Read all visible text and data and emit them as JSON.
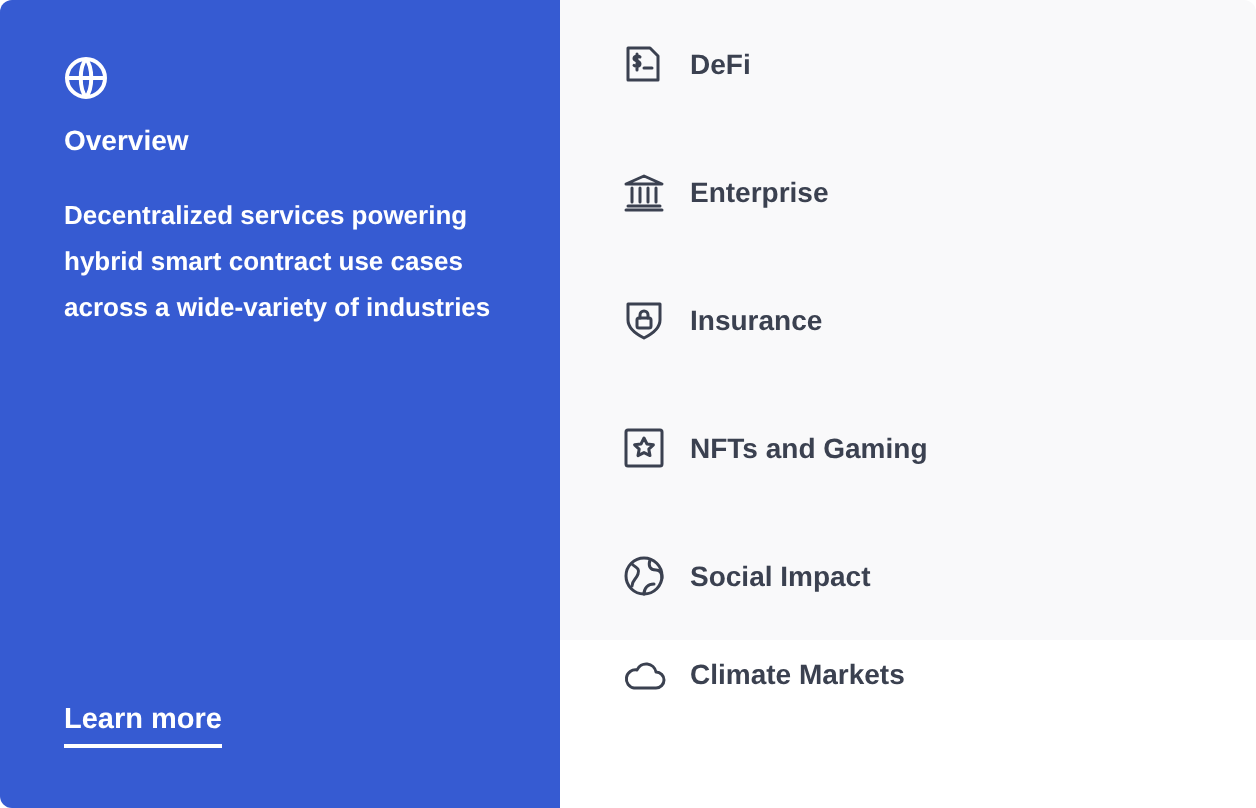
{
  "overview": {
    "title": "Overview",
    "description": "Decentralized services powering hybrid smart contract use cases across a wide-variety of industries",
    "link": "Learn more"
  },
  "categories": [
    {
      "kind": "document",
      "label": "DeFi"
    },
    {
      "kind": "bank",
      "label": "Enterprise"
    },
    {
      "kind": "shield",
      "label": "Insurance"
    },
    {
      "kind": "star",
      "label": "NFTs and Gaming"
    },
    {
      "kind": "globe",
      "label": "Social Impact"
    },
    {
      "kind": "cloud",
      "label": "Climate Markets"
    }
  ]
}
